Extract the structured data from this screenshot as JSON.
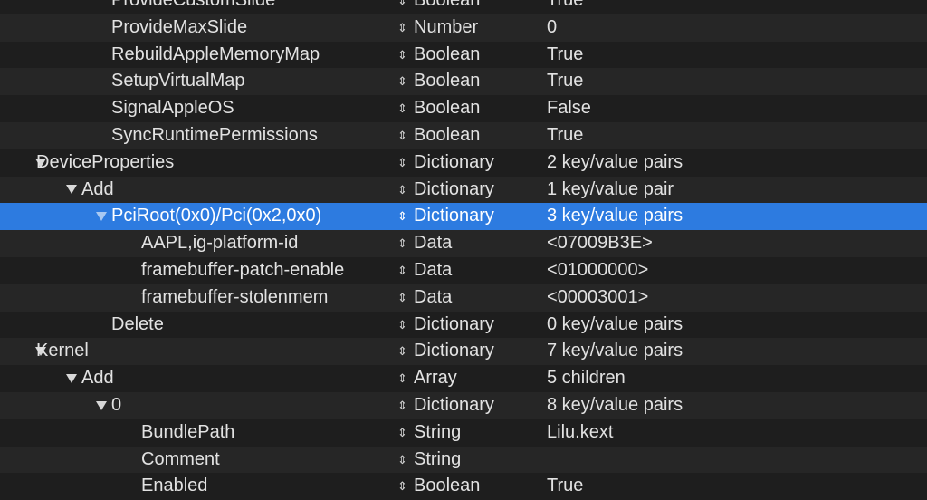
{
  "rows": [
    {
      "key": "ProvideCustomSlide",
      "type": "Boolean",
      "value": "True",
      "level": 3,
      "expanded": false,
      "has_children": false,
      "selected": false
    },
    {
      "key": "ProvideMaxSlide",
      "type": "Number",
      "value": "0",
      "level": 3,
      "expanded": false,
      "has_children": false,
      "selected": false
    },
    {
      "key": "RebuildAppleMemoryMap",
      "type": "Boolean",
      "value": "True",
      "level": 3,
      "expanded": false,
      "has_children": false,
      "selected": false
    },
    {
      "key": "SetupVirtualMap",
      "type": "Boolean",
      "value": "True",
      "level": 3,
      "expanded": false,
      "has_children": false,
      "selected": false
    },
    {
      "key": "SignalAppleOS",
      "type": "Boolean",
      "value": "False",
      "level": 3,
      "expanded": false,
      "has_children": false,
      "selected": false
    },
    {
      "key": "SyncRuntimePermissions",
      "type": "Boolean",
      "value": "True",
      "level": 3,
      "expanded": false,
      "has_children": false,
      "selected": false
    },
    {
      "key": "DeviceProperties",
      "type": "Dictionary",
      "value": "2 key/value pairs",
      "level": 0,
      "expanded": true,
      "has_children": true,
      "selected": false
    },
    {
      "key": "Add",
      "type": "Dictionary",
      "value": "1 key/value pair",
      "level": 1,
      "expanded": true,
      "has_children": true,
      "selected": false
    },
    {
      "key": "PciRoot(0x0)/Pci(0x2,0x0)",
      "type": "Dictionary",
      "value": "3 key/value pairs",
      "level": 2,
      "expanded": true,
      "has_children": true,
      "selected": true
    },
    {
      "key": "AAPL,ig-platform-id",
      "type": "Data",
      "value": "<07009B3E>",
      "level": 4,
      "expanded": false,
      "has_children": false,
      "selected": false
    },
    {
      "key": "framebuffer-patch-enable",
      "type": "Data",
      "value": "<01000000>",
      "level": 4,
      "expanded": false,
      "has_children": false,
      "selected": false
    },
    {
      "key": "framebuffer-stolenmem",
      "type": "Data",
      "value": "<00003001>",
      "level": 4,
      "expanded": false,
      "has_children": false,
      "selected": false
    },
    {
      "key": "Delete",
      "type": "Dictionary",
      "value": "0 key/value pairs",
      "level": 2,
      "expanded": false,
      "has_children": false,
      "selected": false
    },
    {
      "key": "Kernel",
      "type": "Dictionary",
      "value": "7 key/value pairs",
      "level": 0,
      "expanded": true,
      "has_children": true,
      "selected": false
    },
    {
      "key": "Add",
      "type": "Array",
      "value": "5 children",
      "level": 1,
      "expanded": true,
      "has_children": true,
      "selected": false
    },
    {
      "key": "0",
      "type": "Dictionary",
      "value": "8 key/value pairs",
      "level": 2,
      "expanded": true,
      "has_children": true,
      "selected": false
    },
    {
      "key": "BundlePath",
      "type": "String",
      "value": "Lilu.kext",
      "level": 4,
      "expanded": false,
      "has_children": false,
      "selected": false
    },
    {
      "key": "Comment",
      "type": "String",
      "value": "",
      "level": 4,
      "expanded": false,
      "has_children": false,
      "selected": false
    },
    {
      "key": "Enabled",
      "type": "Boolean",
      "value": "True",
      "level": 4,
      "expanded": false,
      "has_children": false,
      "selected": false
    }
  ],
  "icons": {
    "disclosure": "disclosure-triangle-icon",
    "type_stepper": "up-down-stepper-icon"
  },
  "colors": {
    "background": "#1e1e1e",
    "alternate_row": "#262626",
    "selection": "#2d7be0",
    "text": "#e2e2e2"
  }
}
